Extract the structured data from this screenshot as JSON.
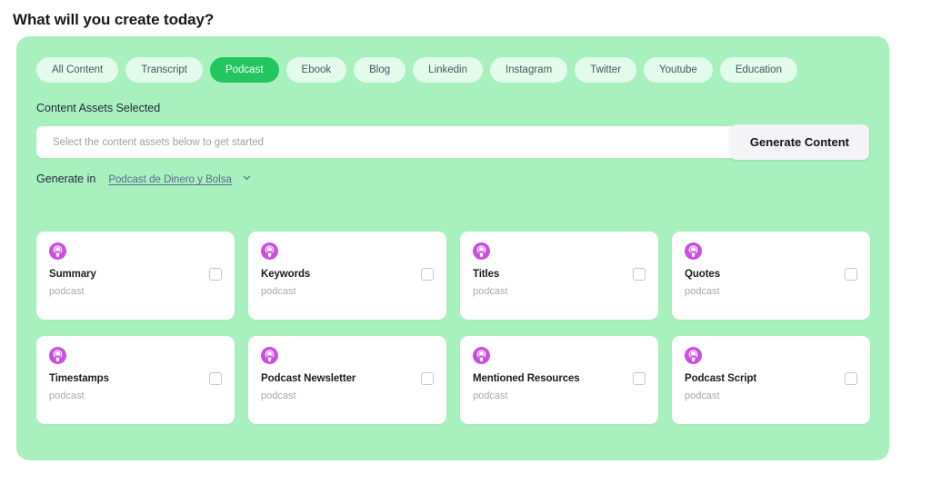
{
  "page": {
    "title": "What will you create today?"
  },
  "tabs": [
    {
      "label": "All Content",
      "active": false
    },
    {
      "label": "Transcript",
      "active": false
    },
    {
      "label": "Podcast",
      "active": true
    },
    {
      "label": "Ebook",
      "active": false
    },
    {
      "label": "Blog",
      "active": false
    },
    {
      "label": "Linkedin",
      "active": false
    },
    {
      "label": "Instagram",
      "active": false
    },
    {
      "label": "Twitter",
      "active": false
    },
    {
      "label": "Youtube",
      "active": false
    },
    {
      "label": "Education",
      "active": false
    }
  ],
  "assets": {
    "section_label": "Content Assets Selected",
    "input_value": "",
    "input_placeholder": "Select the content assets below to get started",
    "generate_button_label": "Generate Content"
  },
  "generate_in": {
    "label": "Generate in",
    "selected_option": "Podcast de Dinero y Bolsa",
    "chevron_icon": "chevron-down-icon"
  },
  "cards": [
    {
      "title": "Summary",
      "subtitle": "podcast",
      "icon": "podcast-icon",
      "checked": false
    },
    {
      "title": "Keywords",
      "subtitle": "podcast",
      "icon": "podcast-icon",
      "checked": false
    },
    {
      "title": "Titles",
      "subtitle": "podcast",
      "icon": "podcast-icon",
      "checked": false
    },
    {
      "title": "Quotes",
      "subtitle": "podcast",
      "icon": "podcast-icon",
      "checked": false
    },
    {
      "title": "Timestamps",
      "subtitle": "podcast",
      "icon": "podcast-icon",
      "checked": false
    },
    {
      "title": "Podcast Newsletter",
      "subtitle": "podcast",
      "icon": "podcast-icon",
      "checked": false
    },
    {
      "title": "Mentioned Resources",
      "subtitle": "podcast",
      "icon": "podcast-icon",
      "checked": false
    },
    {
      "title": "Podcast Script",
      "subtitle": "podcast",
      "icon": "podcast-icon",
      "checked": false
    }
  ],
  "colors": {
    "panel_background": "#a9f0bf",
    "tab_inactive_background": "#e2fbea",
    "tab_active_background": "#22c55e",
    "tab_active_text": "#ffffff",
    "card_background": "#ffffff",
    "podcast_icon": "#cc4ee0",
    "link_text": "#5b6b8c"
  }
}
